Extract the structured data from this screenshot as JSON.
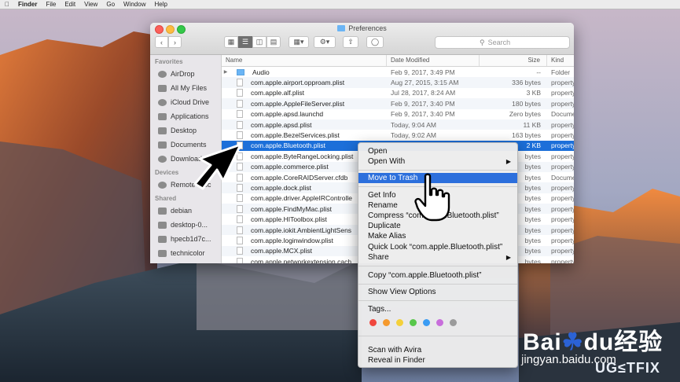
{
  "menubar": {
    "items": [
      "Finder",
      "File",
      "Edit",
      "View",
      "Go",
      "Window",
      "Help"
    ]
  },
  "window": {
    "title": "Preferences",
    "search_placeholder": "Search"
  },
  "sidebar": {
    "favorites_header": "Favorites",
    "favorites": [
      "AirDrop",
      "All My Files",
      "iCloud Drive",
      "Applications",
      "Desktop",
      "Documents",
      "Downloads"
    ],
    "devices_header": "Devices",
    "devices": [
      "Remote Disc"
    ],
    "shared_header": "Shared",
    "shared": [
      "debian",
      "desktop-0...",
      "hpecb1d7c...",
      "technicolor"
    ]
  },
  "columns": {
    "name": "Name",
    "date": "Date Modified",
    "size": "Size",
    "kind": "Kind"
  },
  "files": [
    {
      "name": "Audio",
      "date": "Feb 9, 2017, 3:49 PM",
      "size": "--",
      "kind": "Folder"
    },
    {
      "name": "com.apple.airport.opproam.plist",
      "date": "Aug 27, 2015, 3:15 AM",
      "size": "336 bytes",
      "kind": "property"
    },
    {
      "name": "com.apple.alf.plist",
      "date": "Jul 28, 2017, 8:24 AM",
      "size": "3 KB",
      "kind": "property"
    },
    {
      "name": "com.apple.AppleFileServer.plist",
      "date": "Feb 9, 2017, 3:40 PM",
      "size": "180 bytes",
      "kind": "property"
    },
    {
      "name": "com.apple.apsd.launchd",
      "date": "Feb 9, 2017, 3:40 PM",
      "size": "Zero bytes",
      "kind": "Docume"
    },
    {
      "name": "com.apple.apsd.plist",
      "date": "Today, 9:04 AM",
      "size": "11 KB",
      "kind": "property"
    },
    {
      "name": "com.apple.BezelServices.plist",
      "date": "Today, 9:02 AM",
      "size": "163 bytes",
      "kind": "property"
    },
    {
      "name": "com.apple.Bluetooth.plist",
      "date": "",
      "size": "2 KB",
      "kind": "property"
    },
    {
      "name": "com.apple.ByteRangeLocking.plist",
      "date": "",
      "size": "bytes",
      "kind": "property"
    },
    {
      "name": "com.apple.commerce.plist",
      "date": "",
      "size": "bytes",
      "kind": "property"
    },
    {
      "name": "com.apple.CoreRAIDServer.cfdb",
      "date": "",
      "size": "bytes",
      "kind": "Docume"
    },
    {
      "name": "com.apple.dock.plist",
      "date": "",
      "size": "bytes",
      "kind": "property"
    },
    {
      "name": "com.apple.driver.AppleIRControlle",
      "date": "",
      "size": "bytes",
      "kind": "property"
    },
    {
      "name": "com.apple.FindMyMac.plist",
      "date": "",
      "size": "bytes",
      "kind": "property"
    },
    {
      "name": "com.apple.HIToolbox.plist",
      "date": "",
      "size": "bytes",
      "kind": "property"
    },
    {
      "name": "com.apple.iokit.AmbientLightSens",
      "date": "",
      "size": "bytes",
      "kind": "property"
    },
    {
      "name": "com.apple.loginwindow.plist",
      "date": "",
      "size": "bytes",
      "kind": "property"
    },
    {
      "name": "com.apple.MCX.plist",
      "date": "",
      "size": "bytes",
      "kind": "property"
    },
    {
      "name": "com.apple.networkextension.cach",
      "date": "",
      "size": "bytes",
      "kind": "property"
    }
  ],
  "context_menu": {
    "open": "Open",
    "open_with": "Open With",
    "move_to_trash": "Move to Trash",
    "get_info": "Get Info",
    "rename": "Rename",
    "compress": "Compress “com.apple.Bluetooth.plist”",
    "duplicate": "Duplicate",
    "make_alias": "Make Alias",
    "quick_look": "Quick Look “com.apple.Bluetooth.plist”",
    "share": "Share",
    "copy": "Copy “com.apple.Bluetooth.plist”",
    "show_view_options": "Show View Options",
    "tags": "Tags...",
    "tag_colors": [
      "#f0473e",
      "#f59a2e",
      "#f4d03a",
      "#58c74a",
      "#3b9cf3",
      "#c86edb",
      "#9b9b9b"
    ],
    "scan_with_avira": "Scan with Avira",
    "reveal_in_finder": "Reveal in Finder"
  },
  "watermark": {
    "baidu_text": "Bai",
    "baidu_paw": "☘",
    "baidu_text2": "du",
    "baidu_cn": "经验",
    "url": "jingyan.baidu.com",
    "ugetfix": "UG≤TFIX"
  }
}
